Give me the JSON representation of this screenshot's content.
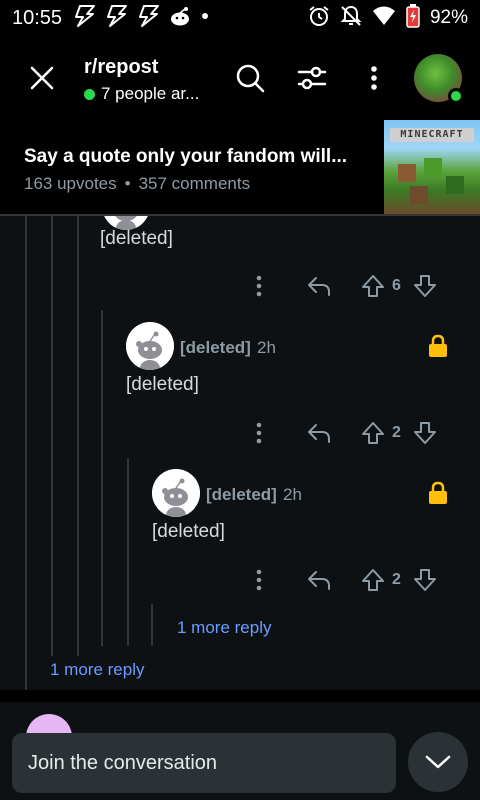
{
  "status_bar": {
    "time": "10:55",
    "battery": "92%",
    "left_icons": [
      "flash-icon",
      "flash-icon",
      "flash-icon",
      "reddit-icon",
      "dot-icon"
    ],
    "right_icons": [
      "alarm-icon",
      "mute-icon",
      "wifi-icon",
      "battery-icon"
    ]
  },
  "header": {
    "subreddit": "r/repost",
    "online": "7 people ar..."
  },
  "post": {
    "title": "Say a quote only your fandom will...",
    "upvotes": "163 upvotes",
    "separator": "•",
    "comments": "357 comments",
    "thumbnail_logo": "MINECRAFT"
  },
  "comments": [
    {
      "author": "",
      "time": "",
      "body": "[deleted]",
      "votes": "6"
    },
    {
      "author": "[deleted]",
      "time": "2h",
      "body": "[deleted]",
      "votes": "2"
    },
    {
      "author": "[deleted]",
      "time": "2h",
      "body": "[deleted]",
      "votes": "2"
    }
  ],
  "more_replies": {
    "inner": "1 more reply",
    "outer": "1 more reply"
  },
  "footer": {
    "join_placeholder": "Join the conversation"
  },
  "colors": {
    "background": "#0e1113",
    "accent_link": "#6a9cff",
    "online_green": "#2bd84c",
    "lock_yellow": "#ffbf0b",
    "muted_text": "#8e9ba5"
  }
}
